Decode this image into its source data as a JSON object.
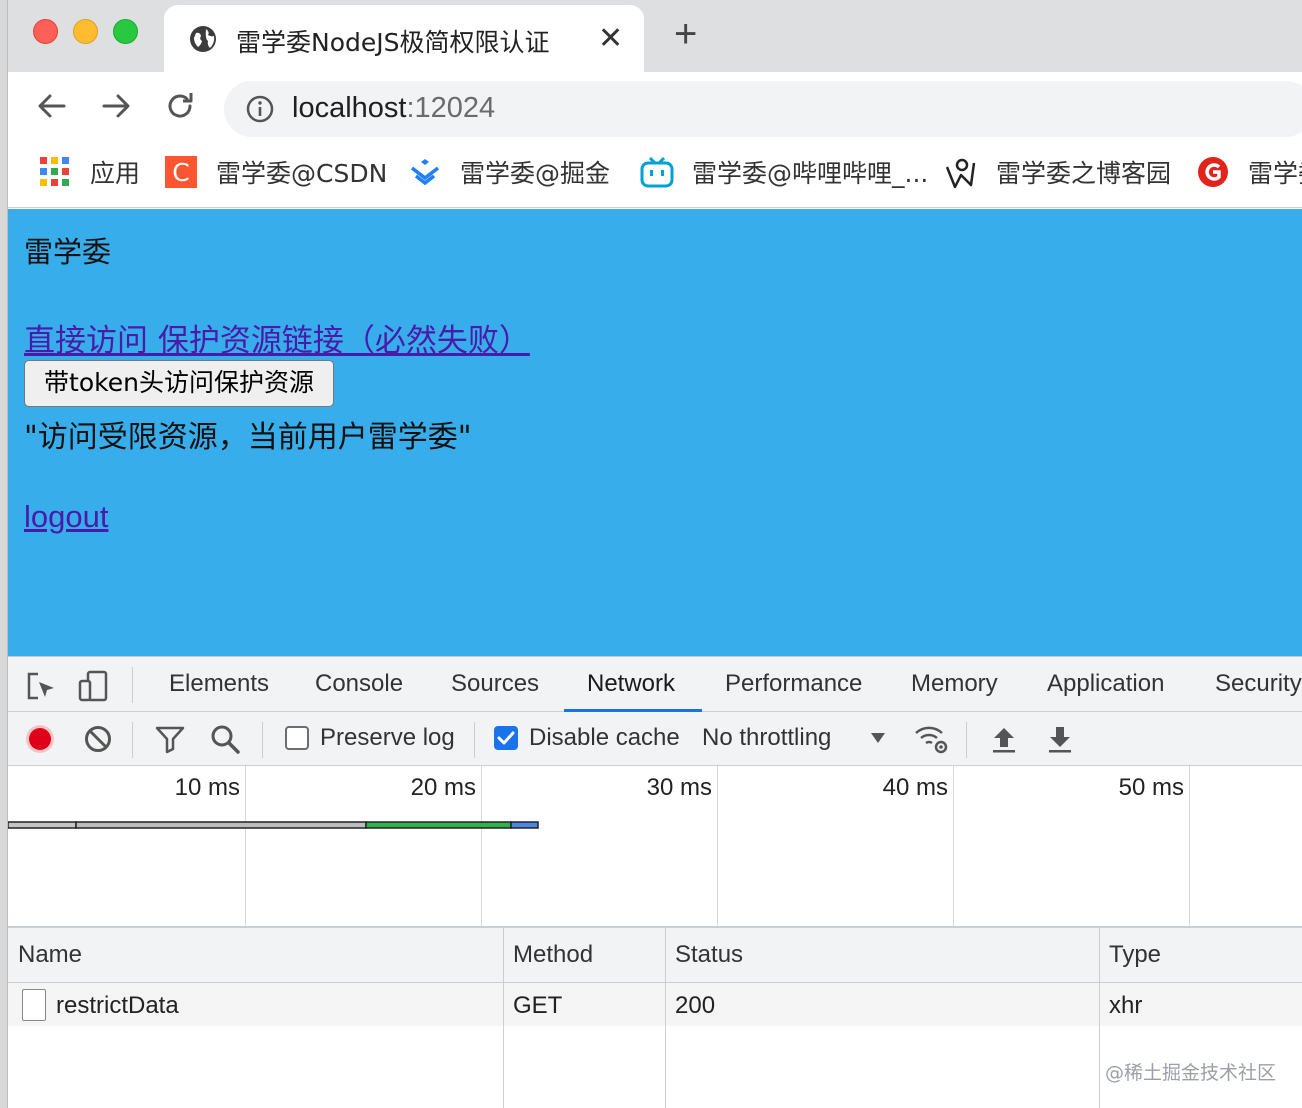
{
  "browser": {
    "tab": {
      "title": "雷学委NodeJS极简权限认证",
      "close_glyph": "✕",
      "favicon": "globe-icon"
    },
    "new_tab_glyph": "+",
    "url": {
      "host": "localhost",
      "port": ":12024"
    },
    "bookmarks": [
      {
        "label": "应用",
        "icon": "apps-grid-icon"
      },
      {
        "label": "雷学委@CSDN",
        "icon": "csdn-icon"
      },
      {
        "label": "雷学委@掘金",
        "icon": "juejin-icon"
      },
      {
        "label": "雷学委@哔哩哔哩_...",
        "icon": "bilibili-icon"
      },
      {
        "label": "雷学委之博客园",
        "icon": "cnblogs-icon"
      },
      {
        "label": "雷学委",
        "icon": "ibm-icon"
      }
    ]
  },
  "page": {
    "heading": "雷学委",
    "protected_link": "直接访问 保护资源链接（必然失败）",
    "token_button": "带token头访问保护资源",
    "result_text": "\"访问受限资源，当前用户雷学委\"",
    "logout_link": "logout",
    "background": "#37adeb"
  },
  "devtools": {
    "tabs": [
      "Elements",
      "Console",
      "Sources",
      "Network",
      "Performance",
      "Memory",
      "Application",
      "Security"
    ],
    "active_tab": "Network",
    "controls": {
      "preserve_log": {
        "label": "Preserve log",
        "checked": false
      },
      "disable_cache": {
        "label": "Disable cache",
        "checked": true
      },
      "throttling": "No throttling"
    },
    "timeline_ticks": [
      "10 ms",
      "20 ms",
      "30 ms",
      "40 ms",
      "50 ms"
    ],
    "table": {
      "columns": [
        "Name",
        "Method",
        "Status",
        "Type"
      ],
      "rows": [
        {
          "name": "restrictData",
          "method": "GET",
          "status": "200",
          "type": "xhr"
        }
      ]
    }
  },
  "watermark": "@稀土掘金技术社区"
}
